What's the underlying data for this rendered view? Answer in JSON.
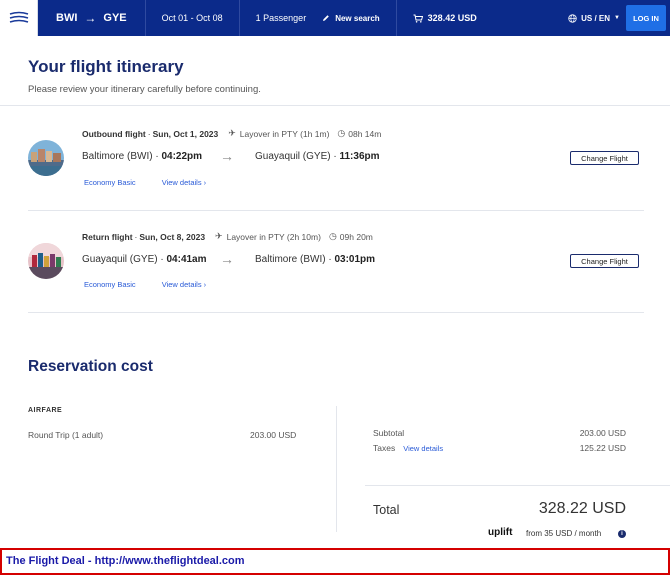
{
  "header": {
    "origin": "BWI",
    "destination": "GYE",
    "dates": "Oct 01 - Oct 08",
    "passengers": "1 Passenger",
    "new_search": "New search",
    "cart_total": "328.42 USD",
    "language": "US / EN",
    "login": "LOG IN"
  },
  "itinerary": {
    "title": "Your flight itinerary",
    "subtitle": "Please review your itinerary carefully before continuing."
  },
  "flights": [
    {
      "label": "Outbound flight",
      "date": "Sun, Oct 1, 2023",
      "layover": "Layover in PTY (1h 1m)",
      "duration": "08h 14m",
      "from_city": "Baltimore (BWI) · ",
      "from_time": "04:22pm",
      "to_city": "Guayaquil (GYE) · ",
      "to_time": "11:36pm",
      "fare_class": "Economy Basic",
      "details": "View details",
      "change": "Change Flight"
    },
    {
      "label": "Return flight",
      "date": "Sun, Oct 8, 2023",
      "layover": "Layover in PTY (2h 10m)",
      "duration": "09h 20m",
      "from_city": "Guayaquil (GYE) · ",
      "from_time": "04:41am",
      "to_city": "Baltimore (BWI) · ",
      "to_time": "03:01pm",
      "fare_class": "Economy Basic",
      "details": "View details",
      "change": "Change Flight"
    }
  ],
  "reservation": {
    "title": "Reservation cost",
    "airfare_heading": "AIRFARE",
    "trip_type": "Round Trip (1 adult)",
    "trip_price": "203.00 USD",
    "subtotal_label": "Subtotal",
    "subtotal_value": "203.00 USD",
    "taxes_label": "Taxes",
    "taxes_link": "View details",
    "taxes_value": "125.22 USD",
    "total_label": "Total",
    "total_value": "328.22 USD",
    "uplift_brand": "uplift",
    "uplift_offer": "from 35 USD / month"
  },
  "footer": {
    "text": "The Flight Deal - http://www.theflightdeal.com"
  },
  "colors": {
    "navy": "#0b2a8a",
    "accent_blue": "#1f6fe6",
    "link": "#2a5bd7",
    "footer_border": "#d40000"
  }
}
